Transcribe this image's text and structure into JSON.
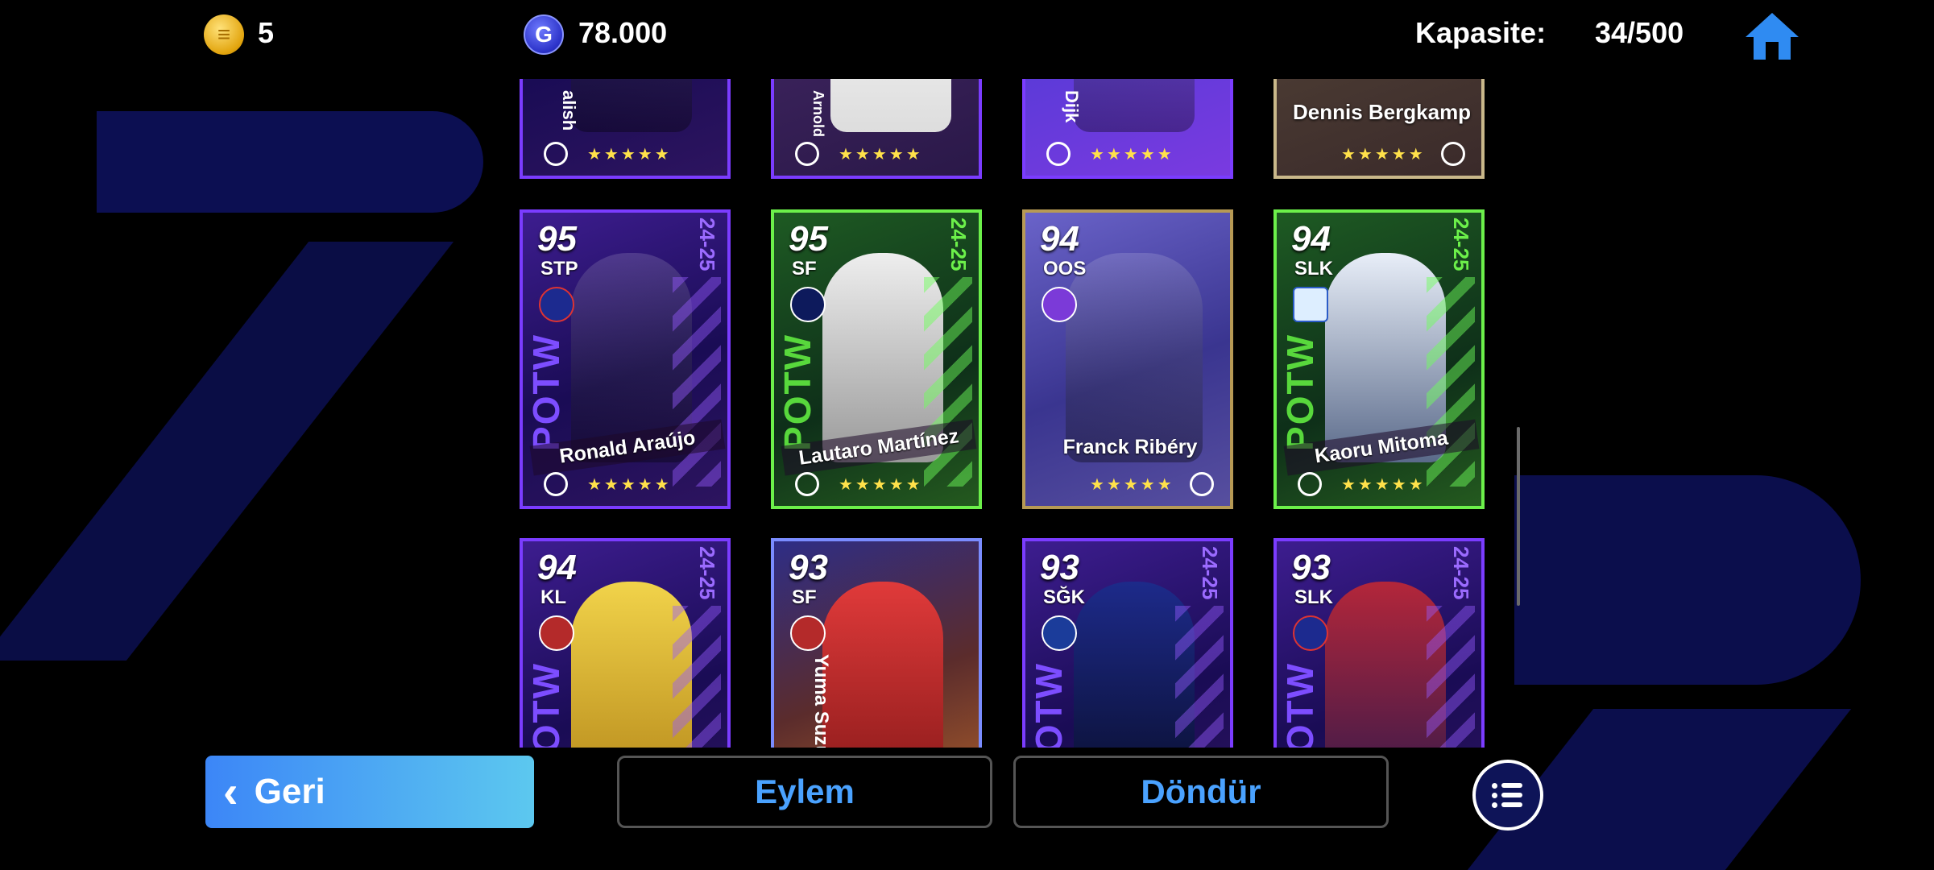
{
  "top_bar": {
    "coins": "5",
    "gp": "78.000",
    "capacity_label": "Kapasite:",
    "capacity_value": "34/500"
  },
  "cards_partial_top": [
    {
      "name": "alish",
      "stars": "★★★★★"
    },
    {
      "name": "Arnold",
      "stars": "★★★★★"
    },
    {
      "name": "Dijk",
      "stars": "★★★★★"
    },
    {
      "name": "Dennis Bergkamp",
      "stars": "★★★★★"
    }
  ],
  "cards_row1": [
    {
      "rating": "95",
      "pos": "STP",
      "season": "24-25",
      "potw": "POTW",
      "name": "Ronald Araújo",
      "stars": "★★★★★"
    },
    {
      "rating": "95",
      "pos": "SF",
      "season": "24-25",
      "potw": "POTW",
      "name": "Lautaro Martínez",
      "stars": "★★★★★"
    },
    {
      "rating": "94",
      "pos": "OOS",
      "season": "",
      "potw": "",
      "name": "Franck Ribéry",
      "stars": "★★★★★"
    },
    {
      "rating": "94",
      "pos": "SLK",
      "season": "24-25",
      "potw": "POTW",
      "name": "Kaoru Mitoma",
      "stars": "★★★★★"
    }
  ],
  "cards_row2": [
    {
      "rating": "94",
      "pos": "KL",
      "season": "24-25",
      "potw": "POTW",
      "name": ""
    },
    {
      "rating": "93",
      "pos": "SF",
      "season": "",
      "potw": "",
      "name": "Yuma Suzu"
    },
    {
      "rating": "93",
      "pos": "SĞK",
      "season": "24-25",
      "potw": "POTW",
      "name": ""
    },
    {
      "rating": "93",
      "pos": "SLK",
      "season": "24-25",
      "potw": "POTW",
      "name": ""
    }
  ],
  "bottom": {
    "back_label": "Geri",
    "action_label": "Eylem",
    "rotate_label": "Döndür"
  },
  "colors": {
    "potw_purple": "#7b3cff",
    "potw_green": "#6cf04a",
    "accent_blue": "#4aa2ff"
  },
  "icons": {
    "coin": "coin-icon",
    "gp": "gp-icon",
    "home": "home-icon",
    "menu": "list-menu-icon"
  }
}
